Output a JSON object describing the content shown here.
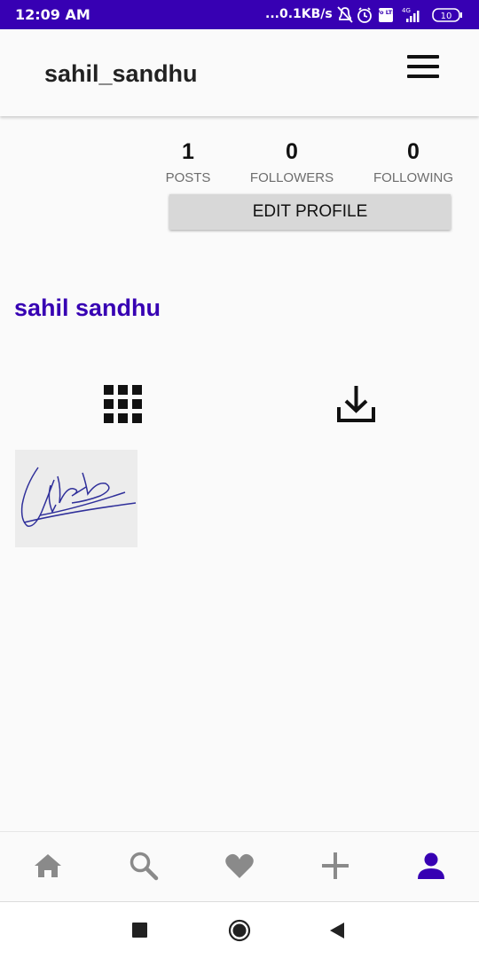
{
  "status_bar": {
    "time": "12:09 AM",
    "network_speed": "...0.1KB/s",
    "icons": [
      "mute-bell-icon",
      "alarm-icon",
      "volte-icon",
      "signal-4g-icon",
      "battery-icon"
    ],
    "battery_level": "10",
    "volte_label": "Vo LTE",
    "network_type": "4G",
    "background_color": "#3700b3"
  },
  "app_bar": {
    "username": "sahil_sandhu",
    "menu_icon": "hamburger-menu-icon"
  },
  "profile": {
    "stats": [
      {
        "count": "1",
        "label": "POSTS"
      },
      {
        "count": "0",
        "label": "FOLLOWERS"
      },
      {
        "count": "0",
        "label": "FOLLOWING"
      }
    ],
    "edit_button_label": "EDIT PROFILE",
    "full_name": "sahil sandhu",
    "accent_color": "#3700b3"
  },
  "tabs": [
    {
      "icon": "grid-icon",
      "selected": true
    },
    {
      "icon": "saved-download-icon",
      "selected": false
    }
  ],
  "posts": [
    {
      "type": "image",
      "content": "signature-image"
    }
  ],
  "bottom_nav": [
    {
      "icon": "home-icon",
      "active": false
    },
    {
      "icon": "search-icon",
      "active": false
    },
    {
      "icon": "heart-icon",
      "active": false
    },
    {
      "icon": "add-icon",
      "active": false
    },
    {
      "icon": "profile-icon",
      "active": true
    }
  ],
  "system_nav": [
    "recents-icon",
    "home-circle-icon",
    "back-icon"
  ]
}
